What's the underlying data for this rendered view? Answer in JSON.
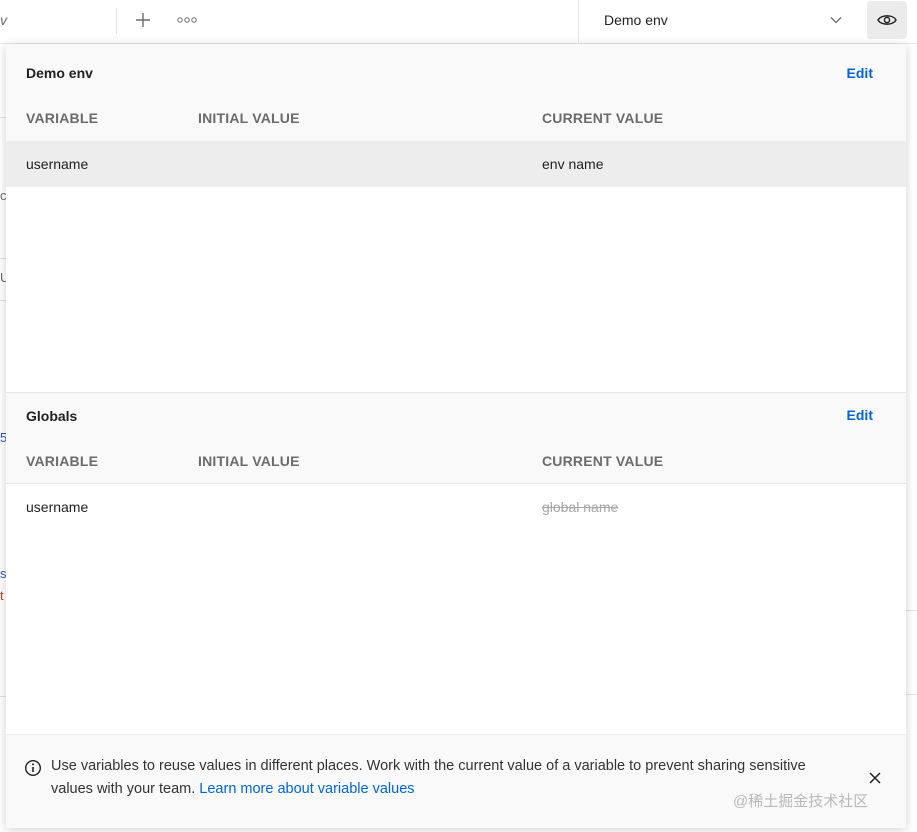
{
  "topbar": {
    "tab_fragment": "v",
    "environment_selector": {
      "selected": "Demo env"
    }
  },
  "background_fragments": {
    "frag1": "c",
    "frag2": "U",
    "frag3": "5",
    "frag4": "s",
    "frag5": "t"
  },
  "colors": {
    "accent": "#0265d2",
    "text": "#212121",
    "muted": "#6b6b6b",
    "struck": "#a6a6a6"
  },
  "environment_section": {
    "title": "Demo env",
    "edit_label": "Edit",
    "columns": [
      "VARIABLE",
      "INITIAL VALUE",
      "CURRENT VALUE"
    ],
    "rows": [
      {
        "variable": "username",
        "initial_value": "",
        "current_value": "env name"
      }
    ]
  },
  "globals_section": {
    "title": "Globals",
    "edit_label": "Edit",
    "columns": [
      "VARIABLE",
      "INITIAL VALUE",
      "CURRENT VALUE"
    ],
    "rows": [
      {
        "variable": "username",
        "initial_value": "",
        "current_value": "global name"
      }
    ]
  },
  "banner": {
    "text": "Use variables to reuse values in different places. Work with the current value of a variable to prevent sharing sensitive values with your team.",
    "link_label": "Learn more about variable values"
  },
  "watermark": "@稀土掘金技术社区"
}
